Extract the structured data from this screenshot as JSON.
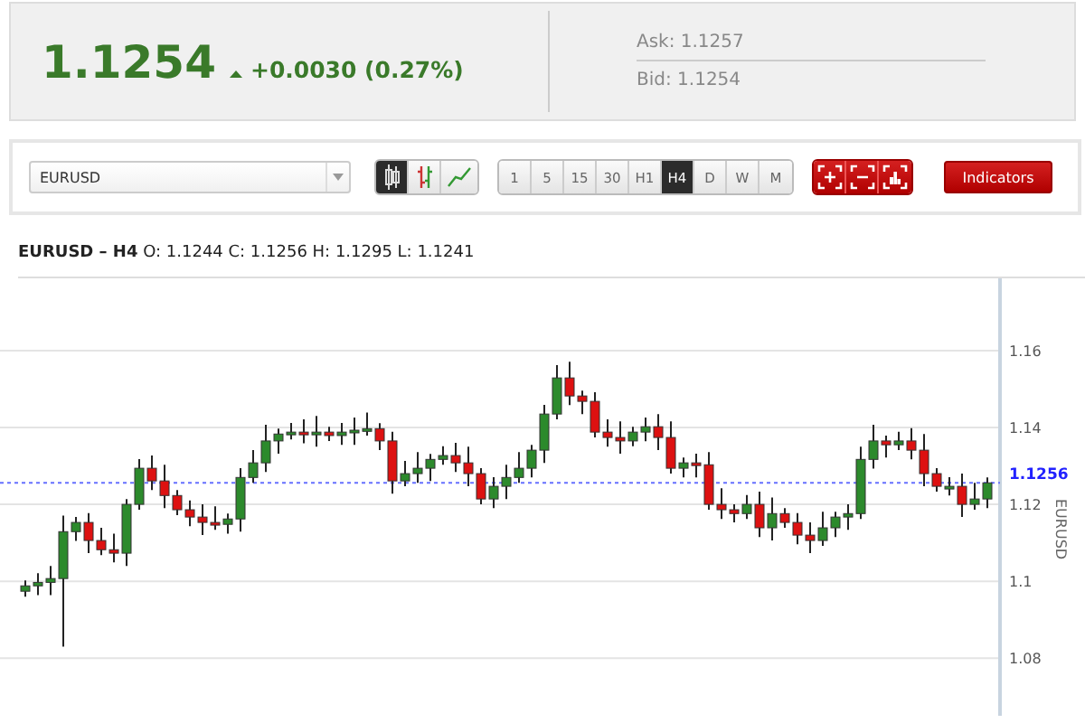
{
  "quote": {
    "price": "1.1254",
    "rising": true,
    "change": "+0.0030 (0.27%)",
    "ask": "Ask: 1.1257",
    "bid": "Bid: 1.1254"
  },
  "toolbar": {
    "symbol": "EURUSD",
    "chart_types": [
      {
        "kind": "candles",
        "selected": true
      },
      {
        "kind": "bars",
        "selected": false
      },
      {
        "kind": "line",
        "selected": false
      }
    ],
    "timeframes": [
      {
        "label": "1",
        "selected": false
      },
      {
        "label": "5",
        "selected": false
      },
      {
        "label": "15",
        "selected": false
      },
      {
        "label": "30",
        "selected": false
      },
      {
        "label": "H1",
        "selected": false
      },
      {
        "label": "H4",
        "selected": true
      },
      {
        "label": "D",
        "selected": false
      },
      {
        "label": "W",
        "selected": false
      },
      {
        "label": "M",
        "selected": false
      }
    ],
    "indicators": "Indicators"
  },
  "chart": {
    "title": "**EURUSD – H4** O: 1.1244 C: 1.1256 H: 1.1295 L: 1.1241",
    "current_price": "1.1256",
    "chart_data": {
      "type": "candlestick",
      "ylabel": "EURUSD",
      "ylim": [
        1.065,
        1.1788
      ],
      "yticks": [
        1.08,
        1.1,
        1.12,
        1.14,
        1.16
      ],
      "grid": true,
      "ref_lines": [
        {
          "axis": "y",
          "value": 1.1256,
          "color": "#6670ff"
        }
      ],
      "ohlc": [
        [
          1.0974,
          1.1002,
          1.096,
          1.0988
        ],
        [
          1.0988,
          1.1021,
          1.0964,
          1.0997
        ],
        [
          1.0997,
          1.104,
          1.0964,
          1.1007
        ],
        [
          1.1007,
          1.1171,
          1.083,
          1.1129
        ],
        [
          1.1129,
          1.1167,
          1.1105,
          1.1153
        ],
        [
          1.1153,
          1.1177,
          1.1073,
          1.1106
        ],
        [
          1.1106,
          1.1139,
          1.1068,
          1.1082
        ],
        [
          1.1082,
          1.1124,
          1.1049,
          1.1073
        ],
        [
          1.1073,
          1.1214,
          1.104,
          1.12
        ],
        [
          1.12,
          1.1318,
          1.1186,
          1.1294
        ],
        [
          1.1294,
          1.1327,
          1.1237,
          1.1261
        ],
        [
          1.1261,
          1.1303,
          1.119,
          1.1223
        ],
        [
          1.1223,
          1.1237,
          1.1172,
          1.1186
        ],
        [
          1.1186,
          1.121,
          1.1143,
          1.1167
        ],
        [
          1.1167,
          1.12,
          1.112,
          1.1153
        ],
        [
          1.1153,
          1.1195,
          1.1134,
          1.1148
        ],
        [
          1.1148,
          1.1176,
          1.1124,
          1.1162
        ],
        [
          1.1162,
          1.1294,
          1.1129,
          1.127
        ],
        [
          1.127,
          1.1341,
          1.1256,
          1.1308
        ],
        [
          1.1308,
          1.1407,
          1.1284,
          1.1365
        ],
        [
          1.1365,
          1.1397,
          1.1332,
          1.1383
        ],
        [
          1.1383,
          1.1412,
          1.1369,
          1.1388
        ],
        [
          1.1388,
          1.1421,
          1.1359,
          1.1383
        ],
        [
          1.1383,
          1.143,
          1.135,
          1.1388
        ],
        [
          1.1388,
          1.1402,
          1.1365,
          1.1379
        ],
        [
          1.1379,
          1.1412,
          1.1355,
          1.1388
        ],
        [
          1.1388,
          1.1426,
          1.1355,
          1.1393
        ],
        [
          1.1393,
          1.1439,
          1.1379,
          1.1397
        ],
        [
          1.1397,
          1.1411,
          1.1341,
          1.1365
        ],
        [
          1.1365,
          1.1389,
          1.1228,
          1.1261
        ],
        [
          1.1261,
          1.1313,
          1.1247,
          1.128
        ],
        [
          1.128,
          1.1336,
          1.1256,
          1.1294
        ],
        [
          1.1294,
          1.1331,
          1.1261,
          1.1317
        ],
        [
          1.1317,
          1.1351,
          1.1303,
          1.1327
        ],
        [
          1.1327,
          1.136,
          1.1284,
          1.1308
        ],
        [
          1.1308,
          1.135,
          1.1247,
          1.128
        ],
        [
          1.128,
          1.1294,
          1.12,
          1.1214
        ],
        [
          1.1214,
          1.1271,
          1.119,
          1.1247
        ],
        [
          1.1247,
          1.1303,
          1.1214,
          1.127
        ],
        [
          1.127,
          1.1336,
          1.1256,
          1.1294
        ],
        [
          1.1294,
          1.1355,
          1.127,
          1.1341
        ],
        [
          1.1341,
          1.1459,
          1.1308,
          1.1435
        ],
        [
          1.1435,
          1.1562,
          1.1421,
          1.1529
        ],
        [
          1.1529,
          1.1571,
          1.1458,
          1.1482
        ],
        [
          1.1482,
          1.1496,
          1.1435,
          1.1468
        ],
        [
          1.1468,
          1.1492,
          1.1374,
          1.1388
        ],
        [
          1.1388,
          1.1421,
          1.135,
          1.1374
        ],
        [
          1.1374,
          1.1416,
          1.1332,
          1.1365
        ],
        [
          1.1365,
          1.1402,
          1.1351,
          1.1388
        ],
        [
          1.1388,
          1.1426,
          1.1364,
          1.1402
        ],
        [
          1.1402,
          1.1435,
          1.1341,
          1.1374
        ],
        [
          1.1374,
          1.1416,
          1.128,
          1.1294
        ],
        [
          1.1294,
          1.1322,
          1.127,
          1.1308
        ],
        [
          1.1308,
          1.1332,
          1.127,
          1.1303
        ],
        [
          1.1303,
          1.1336,
          1.1186,
          1.12
        ],
        [
          1.12,
          1.1242,
          1.1162,
          1.1186
        ],
        [
          1.1186,
          1.12,
          1.1153,
          1.1176
        ],
        [
          1.1176,
          1.1224,
          1.1162,
          1.12
        ],
        [
          1.12,
          1.1233,
          1.1115,
          1.1139
        ],
        [
          1.1139,
          1.1218,
          1.1106,
          1.1176
        ],
        [
          1.1176,
          1.119,
          1.1139,
          1.1153
        ],
        [
          1.1153,
          1.1177,
          1.1096,
          1.112
        ],
        [
          1.112,
          1.1153,
          1.1073,
          1.1106
        ],
        [
          1.1106,
          1.1181,
          1.1092,
          1.1139
        ],
        [
          1.1139,
          1.1181,
          1.1115,
          1.1167
        ],
        [
          1.1167,
          1.12,
          1.1134,
          1.1176
        ],
        [
          1.1176,
          1.135,
          1.1162,
          1.1317
        ],
        [
          1.1317,
          1.1407,
          1.1293,
          1.1365
        ],
        [
          1.1365,
          1.1379,
          1.1322,
          1.1355
        ],
        [
          1.1355,
          1.1389,
          1.1341,
          1.1365
        ],
        [
          1.1365,
          1.1398,
          1.1317,
          1.1341
        ],
        [
          1.1341,
          1.1383,
          1.1247,
          1.128
        ],
        [
          1.128,
          1.1294,
          1.1233,
          1.1247
        ],
        [
          1.1247,
          1.1271,
          1.1223,
          1.1247
        ],
        [
          1.1247,
          1.128,
          1.1167,
          1.12
        ],
        [
          1.12,
          1.1256,
          1.1186,
          1.1214
        ],
        [
          1.1214,
          1.127,
          1.119,
          1.1256
        ]
      ]
    }
  }
}
